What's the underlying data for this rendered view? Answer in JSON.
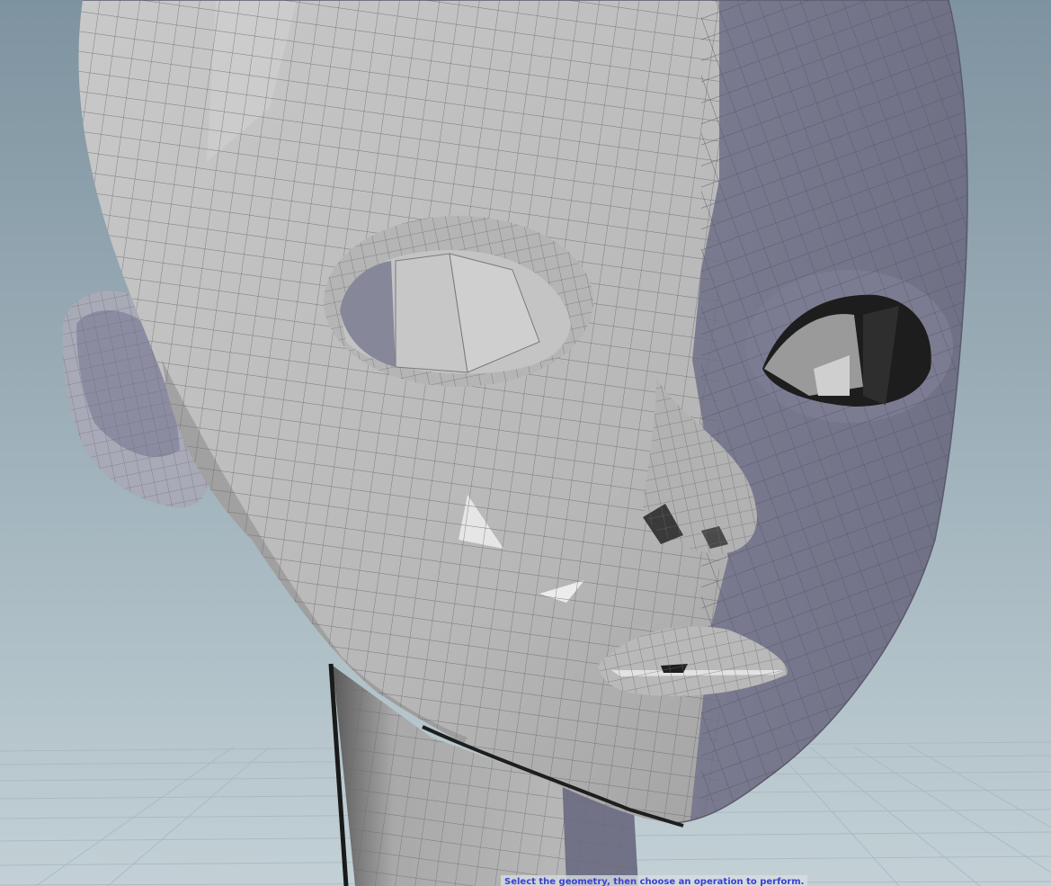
{
  "app": "3D viewport",
  "viewport": {
    "background_top_color": "#7e93a0",
    "background_bottom_color": "#c3d1d6",
    "ground_grid_color": "#a9b9c1",
    "object": "head mesh",
    "lit_side_color": "#bfbfbf",
    "backface_side_color": "#737489",
    "wire_color": "#6b6b6b"
  },
  "status": {
    "message": "Select the geometry, then choose an operation to perform.",
    "color": "#3b3fd0"
  }
}
